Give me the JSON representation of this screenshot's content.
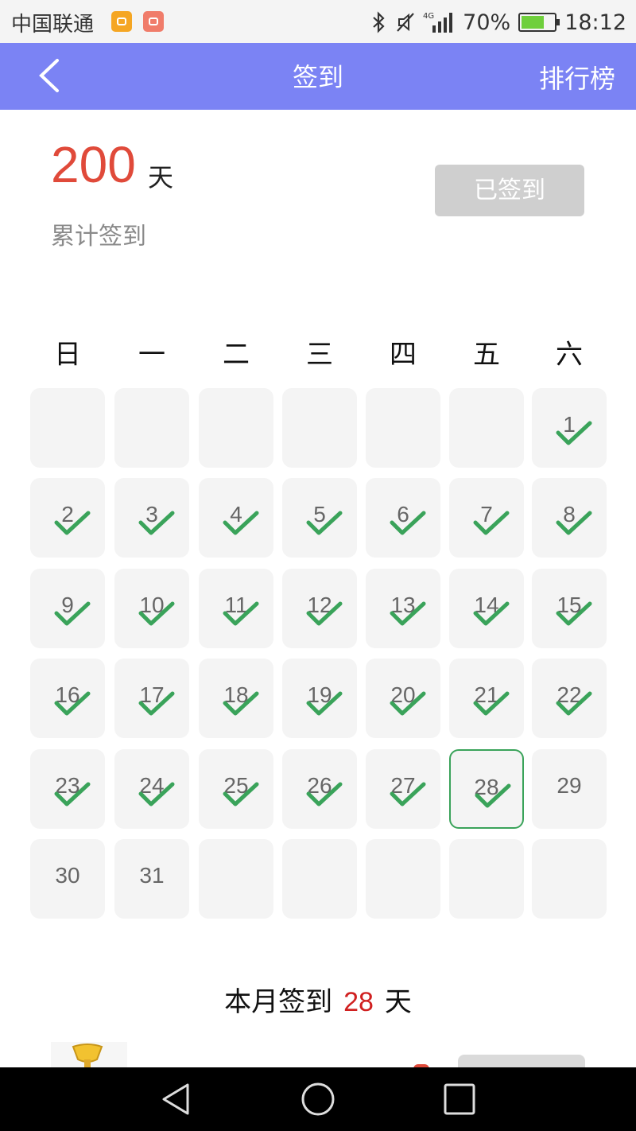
{
  "status_bar": {
    "carrier": "中国联通",
    "battery": "70%",
    "battery_fraction": 0.7,
    "time": "18:12",
    "network": "4G",
    "icons": [
      "bluetooth-icon",
      "mute-icon",
      "signal-icon",
      "battery-icon"
    ]
  },
  "nav": {
    "title": "签到",
    "rank_label": "排行榜",
    "back_icon": "chevron-left-icon"
  },
  "summary": {
    "total_days": "200",
    "unit": "天",
    "label": "累计签到",
    "signed_button": "已签到"
  },
  "weekdays": [
    "日",
    "一",
    "二",
    "三",
    "四",
    "五",
    "六"
  ],
  "calendar": {
    "leading_blanks": 6,
    "days_in_month": 31,
    "today": 28,
    "checked_days": [
      1,
      2,
      3,
      4,
      5,
      6,
      7,
      8,
      9,
      10,
      11,
      12,
      13,
      14,
      15,
      16,
      17,
      18,
      19,
      20,
      21,
      22,
      23,
      24,
      25,
      26,
      27,
      28
    ],
    "total_cells": 42
  },
  "month_summary": {
    "prefix": "本月签到",
    "count": "28",
    "unit": "天"
  },
  "colors": {
    "nav_bg": "#7b83f4",
    "accent_red": "#e04a3a",
    "check_green": "#3aa35a",
    "cell_bg": "#f4f4f4"
  }
}
